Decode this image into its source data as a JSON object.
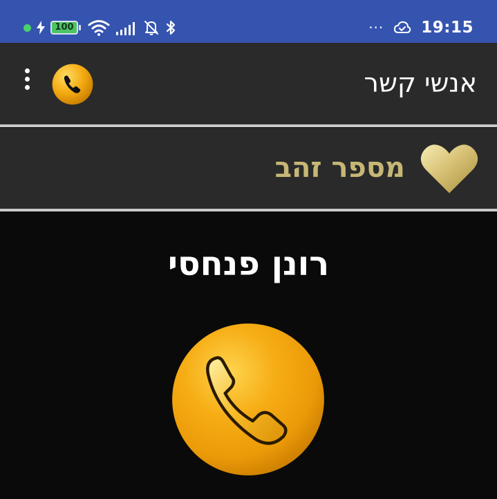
{
  "status_bar": {
    "battery_level": "100",
    "more_indicator": "···",
    "time": "19:15",
    "background": "#3554b0"
  },
  "toolbar": {
    "title": "אנשי קשר",
    "call_icon": "phone-icon",
    "menu_icon": "more-vert-icon"
  },
  "favorite": {
    "label": "מספר זהב",
    "icon": "heart-icon",
    "label_color": "#c7b775"
  },
  "contact": {
    "name": "רונן פנחסי",
    "call_icon": "phone-icon"
  },
  "colors": {
    "gold": "#f2a916",
    "bar_background": "#2a2a2a",
    "page_background": "#0a0a0a"
  }
}
